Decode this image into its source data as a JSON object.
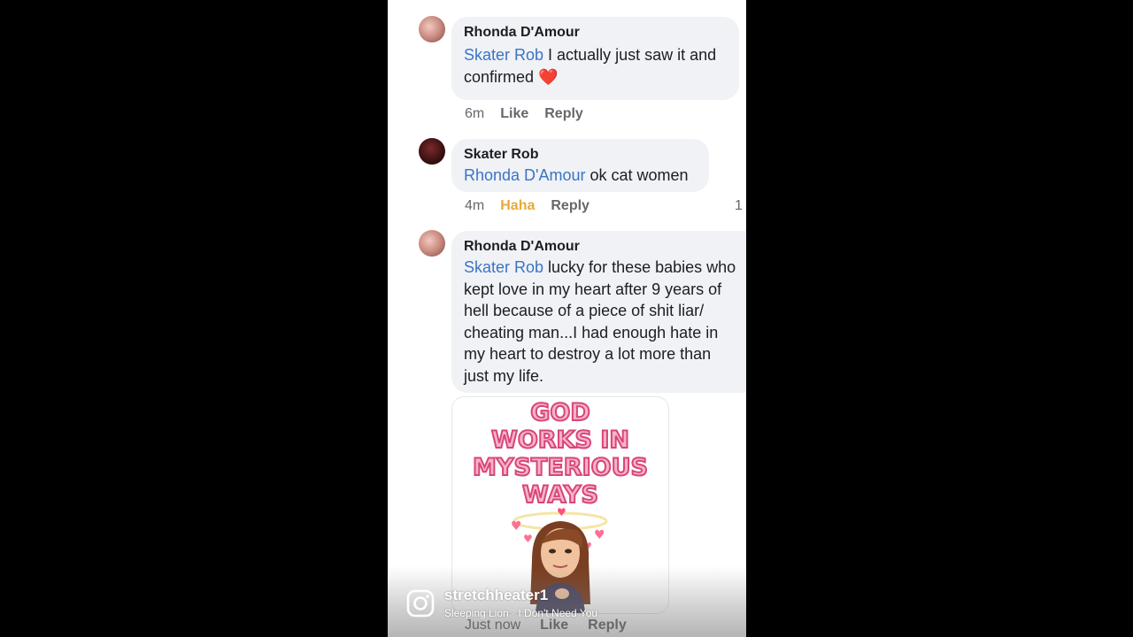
{
  "comments": [
    {
      "author": "Rhonda D'Amour",
      "mention": "Skater Rob",
      "text_line1": " I actually just saw it and",
      "text_line2": "confirmed ",
      "emoji": "❤️",
      "time": "6m",
      "like": "Like",
      "reply": "Reply"
    },
    {
      "author": "Skater Rob",
      "mention": "Rhonda D'Amour",
      "text": " ok cat women",
      "time": "4m",
      "reaction": "Haha",
      "reply": "Reply",
      "reaction_count": "1"
    },
    {
      "author": "Rhonda D'Amour",
      "mention": "Skater Rob",
      "lines": [
        " lucky for these babies who",
        "kept love in my heart after 9 years of",
        "hell because of a piece of shit liar/",
        "cheating man...I had enough hate in",
        "my heart to destroy a lot more than",
        "just my life."
      ],
      "sticker_lines": [
        "GOD",
        "WORKS IN",
        "MYSTERIOUS",
        "WAYS"
      ],
      "time": "Just now",
      "like": "Like",
      "reply": "Reply"
    }
  ],
  "overlay": {
    "username": "stretchheater1",
    "song": "Sleeping Lion · I Don't Need You",
    "icon": "instagram-icon"
  },
  "colors": {
    "mention": "#3b74c6",
    "haha": "#e8a93a",
    "bubble": "#f0f2f5"
  }
}
